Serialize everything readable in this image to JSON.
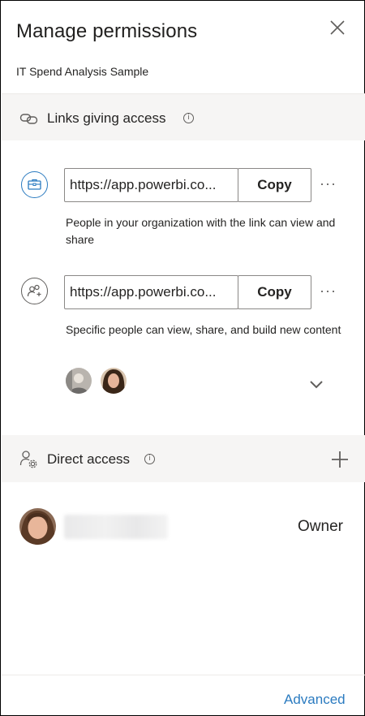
{
  "header": {
    "title": "Manage permissions",
    "subtitle": "IT Spend Analysis Sample"
  },
  "links_section": {
    "label": "Links giving access",
    "links": [
      {
        "url": "https://app.powerbi.co...",
        "copy_label": "Copy",
        "description": "People in your organization with the link can view and share",
        "icon": "briefcase-icon"
      },
      {
        "url": "https://app.powerbi.co...",
        "copy_label": "Copy",
        "description": "Specific people can view, share, and build new content",
        "icon": "people-add-icon"
      }
    ]
  },
  "direct_access": {
    "label": "Direct access",
    "users": [
      {
        "name": "",
        "role": "Owner"
      }
    ]
  },
  "footer": {
    "advanced_label": "Advanced"
  },
  "colors": {
    "accent": "#2b7bc0",
    "section_bg": "#f6f5f4",
    "text": "#252423"
  }
}
